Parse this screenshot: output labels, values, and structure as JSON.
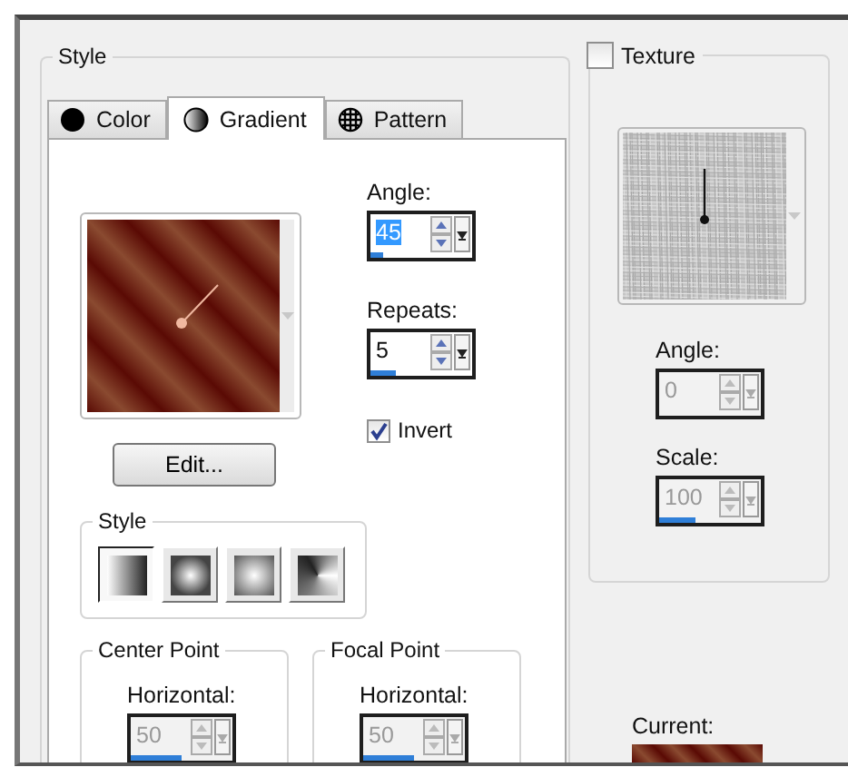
{
  "style_group": {
    "title": "Style"
  },
  "tabs": [
    {
      "label": "Color",
      "kind": "color",
      "selected": false
    },
    {
      "label": "Gradient",
      "kind": "gradient",
      "selected": true
    },
    {
      "label": "Pattern",
      "kind": "pattern",
      "selected": false
    }
  ],
  "gradient": {
    "angle_label": "Angle:",
    "angle": {
      "value": "45",
      "level": 0.12,
      "highlighted": true,
      "disabled": false
    },
    "repeats_label": "Repeats:",
    "repeats": {
      "value": "5",
      "level": 0.25,
      "highlighted": false,
      "disabled": false
    },
    "edit_button": "Edit...",
    "invert": {
      "label": "Invert",
      "checked": true
    },
    "style_group": {
      "title": "Style",
      "buttons": [
        {
          "kind": "linear",
          "selected": true
        },
        {
          "kind": "rectangular",
          "selected": false
        },
        {
          "kind": "sunburst",
          "selected": false
        },
        {
          "kind": "radial",
          "selected": false
        }
      ]
    },
    "center_point": {
      "title": "Center Point",
      "horizontal_label": "Horizontal:",
      "horizontal": {
        "value": "50",
        "level": 0.5,
        "highlighted": false,
        "disabled": true
      }
    },
    "focal_point": {
      "title": "Focal Point",
      "horizontal_label": "Horizontal:",
      "horizontal": {
        "value": "50",
        "level": 0.5,
        "highlighted": false,
        "disabled": true
      }
    }
  },
  "texture": {
    "label": "Texture",
    "checked": false,
    "angle_label": "Angle:",
    "angle": {
      "value": "0",
      "highlighted": false,
      "disabled": true
    },
    "scale_label": "Scale:",
    "scale": {
      "value": "100",
      "level": 0.35,
      "highlighted": false,
      "disabled": true
    }
  },
  "current_label": "Current:"
}
